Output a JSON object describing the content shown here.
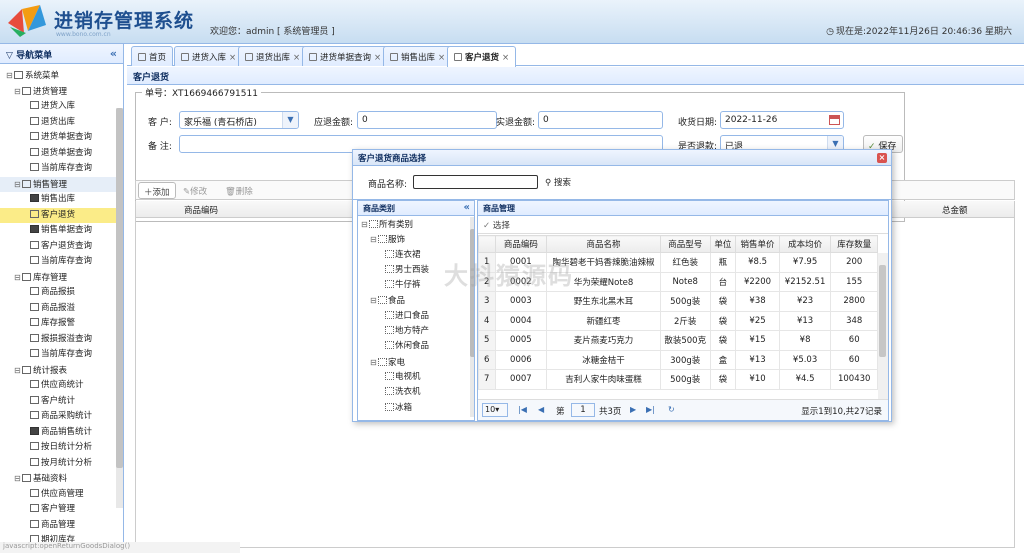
{
  "header": {
    "app_title": "进销存管理系统",
    "subtitle": "www.bono.com.cn",
    "welcome": "欢迎您：admin [ 系统管理员 ]",
    "datetime": "现在是:2022年11月26日 20:46:36 星期六"
  },
  "sidebar": {
    "title": "导航菜单",
    "items": [
      {
        "label": "系统菜单",
        "level": 0
      },
      {
        "label": "进货管理",
        "level": 1
      },
      {
        "label": "进货入库",
        "level": 2
      },
      {
        "label": "退货出库",
        "level": 2
      },
      {
        "label": "进货单据查询",
        "level": 2
      },
      {
        "label": "退货单据查询",
        "level": 2
      },
      {
        "label": "当前库存查询",
        "level": 2
      },
      {
        "label": "销售管理",
        "level": 1
      },
      {
        "label": "销售出库",
        "level": 2
      },
      {
        "label": "客户退货",
        "level": 2
      },
      {
        "label": "销售单据查询",
        "level": 2
      },
      {
        "label": "客户退货查询",
        "level": 2
      },
      {
        "label": "当前库存查询",
        "level": 2
      },
      {
        "label": "库存管理",
        "level": 1
      },
      {
        "label": "商品报损",
        "level": 2
      },
      {
        "label": "商品报溢",
        "level": 2
      },
      {
        "label": "库存报警",
        "level": 2
      },
      {
        "label": "报损报溢查询",
        "level": 2
      },
      {
        "label": "当前库存查询",
        "level": 2
      },
      {
        "label": "统计报表",
        "level": 1
      },
      {
        "label": "供应商统计",
        "level": 2
      },
      {
        "label": "客户统计",
        "level": 2
      },
      {
        "label": "商品采购统计",
        "level": 2
      },
      {
        "label": "商品销售统计",
        "level": 2
      },
      {
        "label": "按日统计分析",
        "level": 2
      },
      {
        "label": "按月统计分析",
        "level": 2
      },
      {
        "label": "基础资料",
        "level": 1
      },
      {
        "label": "供应商管理",
        "level": 2
      },
      {
        "label": "客户管理",
        "level": 2
      },
      {
        "label": "商品管理",
        "level": 2
      },
      {
        "label": "期初库存",
        "level": 2
      }
    ]
  },
  "tabs": [
    {
      "label": "首页"
    },
    {
      "label": "进货入库"
    },
    {
      "label": "退货出库"
    },
    {
      "label": "进货单据查询"
    },
    {
      "label": "销售出库"
    },
    {
      "label": "客户退货"
    }
  ],
  "form": {
    "panel_title": "客户退货",
    "order_no": "单号：XT1669466791511",
    "customer_label": "客  户:",
    "customer_value": "家乐福 (青石桥店)",
    "payable_label": "应退金额:",
    "payable_value": "0",
    "actual_label": "实退金额:",
    "actual_value": "0",
    "date_label": "收货日期:",
    "date_value": "2022-11-26",
    "remark_label": "备  注:",
    "returned_label": "是否退款:",
    "returned_value": "已退",
    "save_label": "保存"
  },
  "toolbar": {
    "add": "添加",
    "edit": "修改",
    "delete": "删除"
  },
  "grid": {
    "col_code": "商品编码",
    "col_total": "总金额"
  },
  "dialog": {
    "title": "客户退货商品选择",
    "search_label": "商品名称:",
    "search_value": "",
    "search_button": "搜索",
    "category_title": "商品类别",
    "categories": [
      {
        "label": "所有类别",
        "level": 0
      },
      {
        "label": "服饰",
        "level": 1
      },
      {
        "label": "连衣裙",
        "level": 2
      },
      {
        "label": "男士西装",
        "level": 2
      },
      {
        "label": "牛仔裤",
        "level": 2
      },
      {
        "label": "食品",
        "level": 1
      },
      {
        "label": "进口食品",
        "level": 2
      },
      {
        "label": "地方特产",
        "level": 2
      },
      {
        "label": "休闲食品",
        "level": 2
      },
      {
        "label": "家电",
        "level": 1
      },
      {
        "label": "电视机",
        "level": 2
      },
      {
        "label": "洗衣机",
        "level": 2
      },
      {
        "label": "冰箱",
        "level": 2
      }
    ],
    "product_title": "商品管理",
    "select_button": "选择",
    "columns": [
      "商品编码",
      "商品名称",
      "商品型号",
      "单位",
      "销售单价",
      "成本均价",
      "库存数量"
    ],
    "rows": [
      {
        "n": "1",
        "code": "0001",
        "name": "陶华碧老干妈香辣脆油辣椒",
        "model": "红色装",
        "unit": "瓶",
        "price": "¥8.5",
        "cost": "¥7.95",
        "stock": "200"
      },
      {
        "n": "2",
        "code": "0002",
        "name": "华为荣耀Note8",
        "model": "Note8",
        "unit": "台",
        "price": "¥2200",
        "cost": "¥2152.51",
        "stock": "155"
      },
      {
        "n": "3",
        "code": "0003",
        "name": "野生东北黑木耳",
        "model": "500g装",
        "unit": "袋",
        "price": "¥38",
        "cost": "¥23",
        "stock": "2800"
      },
      {
        "n": "4",
        "code": "0004",
        "name": "新疆红枣",
        "model": "2斤装",
        "unit": "袋",
        "price": "¥25",
        "cost": "¥13",
        "stock": "348"
      },
      {
        "n": "5",
        "code": "0005",
        "name": "麦片燕麦巧克力",
        "model": "散装500克",
        "unit": "袋",
        "price": "¥15",
        "cost": "¥8",
        "stock": "60"
      },
      {
        "n": "6",
        "code": "0006",
        "name": "冰糖金桔干",
        "model": "300g装",
        "unit": "盒",
        "price": "¥13",
        "cost": "¥5.03",
        "stock": "60"
      },
      {
        "n": "7",
        "code": "0007",
        "name": "吉利人家牛肉味蛋糕",
        "model": "500g装",
        "unit": "袋",
        "price": "¥10",
        "cost": "¥4.5",
        "stock": "100430"
      }
    ],
    "pager": {
      "page_size": "10",
      "page_prefix": "第",
      "page_value": "1",
      "page_total": "共3页",
      "summary": "显示1到10,共27记录"
    }
  },
  "watermark": "大抖猿源码",
  "statusbar": "javascript:openReturnGoodsDialog()"
}
